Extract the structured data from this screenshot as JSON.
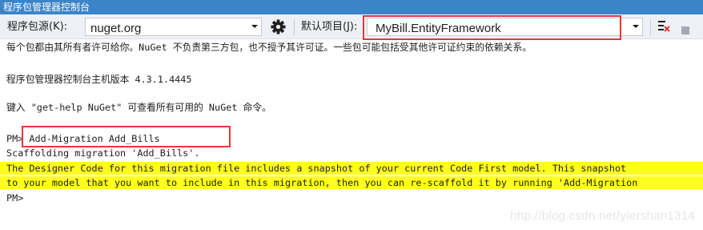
{
  "window": {
    "title": "程序包管理器控制台"
  },
  "toolbar": {
    "source_label": "程序包源(K):",
    "source_value": "nuget.org",
    "settings_icon": "gear-icon",
    "project_label": "默认项目(J):",
    "project_value": "MyBill.EntityFramework",
    "clear_icon": "clear-console-icon",
    "stop_icon": "stop-icon"
  },
  "console": {
    "lines": [
      "每个包都由其所有者许可给你。NuGet 不负责第三方包，也不授予其许可证。一些包可能包括受其他许可证约束的依赖关系。",
      "",
      "程序包管理器控制台主机版本 4.3.1.4445",
      "",
      "键入 \"get-help NuGet\" 可查看所有可用的 NuGet 命令。",
      "",
      "PM> Add-Migration Add_Bills",
      "Scaffolding migration 'Add_Bills'.",
      "The Designer Code for this migration file includes a snapshot of your current Code First model. This snapshot",
      "to your model that you want to include in this migration, then you can re-scaffold it by running 'Add-Migration",
      "PM>"
    ]
  },
  "watermark": "http://blog.csdn.net/yiershan1314",
  "colors": {
    "title_bg": "#3c84c8",
    "highlight": "#ffff1e",
    "annotation_red": "#e63838"
  }
}
